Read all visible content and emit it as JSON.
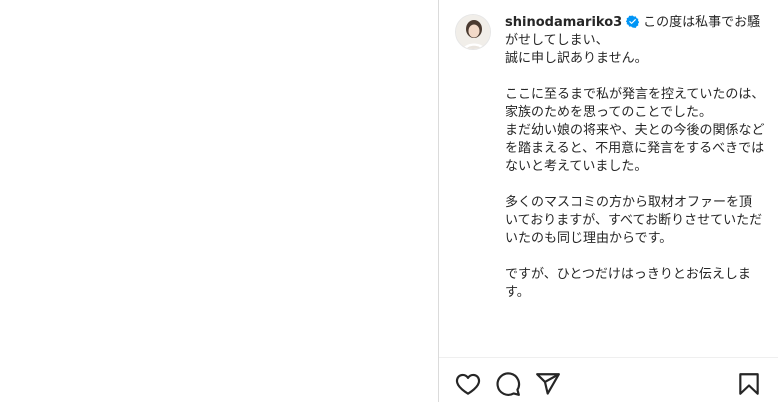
{
  "post": {
    "username": "shinodamariko3",
    "verified_icon": "verified-badge-icon",
    "verified_color": "#0095f6",
    "caption_first": "この度は私事でお騒がせしてしまい、\n誠に申し訳ありません。",
    "caption_paragraphs": [
      "ここに至るまで私が発言を控えていたのは、家族のためを思ってのことでした。\nまだ幼い娘の将来や、夫との今後の関係などを踏まえると、不用意に発言をするべきではないと考えていました。",
      "多くのマスコミの方から取材オファーを頂いておりますが、すべてお断りさせていただいたのも同じ理由からです。",
      "ですが、ひとつだけはっきりとお伝えします。"
    ]
  },
  "actions": {
    "like_icon": "heart-icon",
    "comment_icon": "comment-icon",
    "share_icon": "share-icon",
    "save_icon": "bookmark-icon"
  }
}
